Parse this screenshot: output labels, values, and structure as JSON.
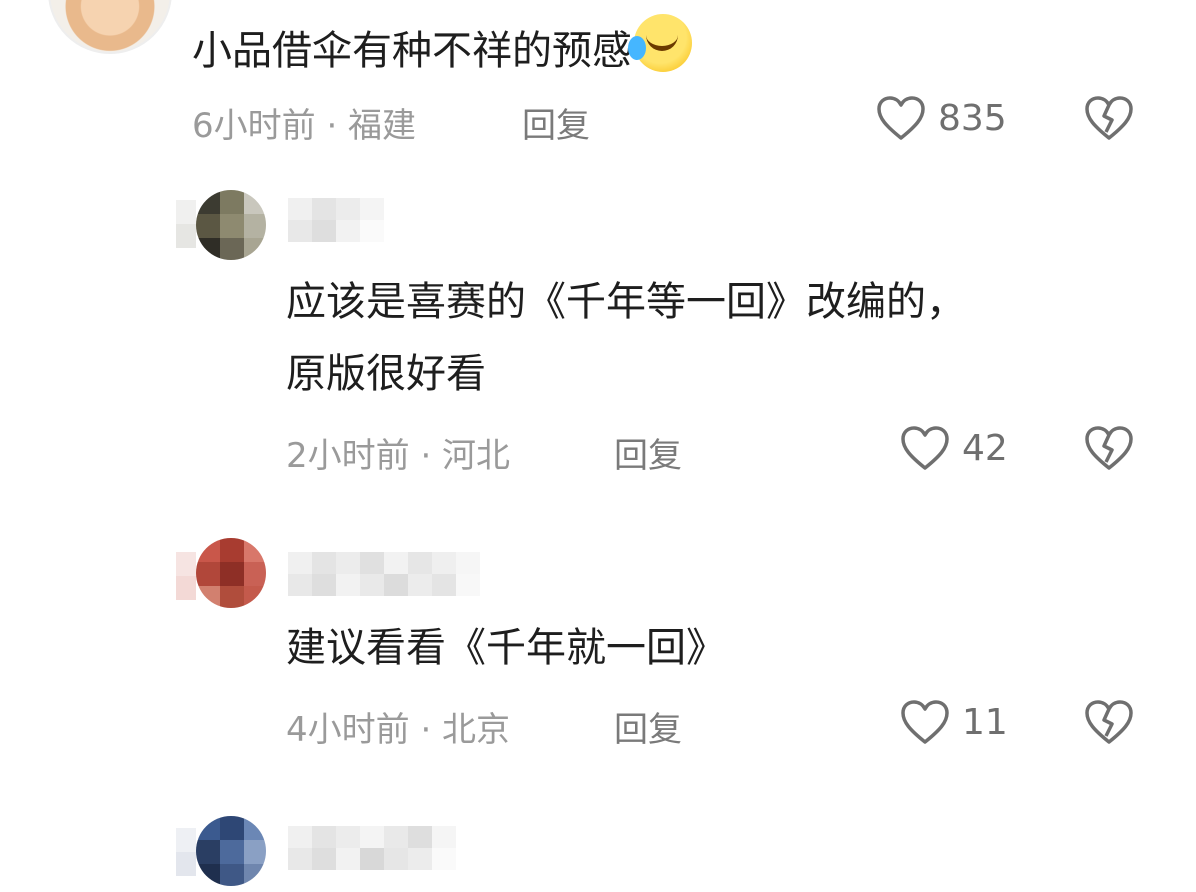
{
  "comments": [
    {
      "text": "小品借伞有种不祥的预感",
      "emoji_icon": "laughing-tears-emoji-icon",
      "meta": "6小时前 · 福建",
      "reply_label": "回复",
      "likes": "835"
    },
    {
      "text_line1": "应该是喜赛的《千年等一回》改编的，",
      "text_line2": "原版很好看",
      "meta": "2小时前 · 河北",
      "reply_label": "回复",
      "likes": "42"
    },
    {
      "text": "建议看看《千年就一回》",
      "meta": "4小时前 · 北京",
      "reply_label": "回复",
      "likes": "11"
    }
  ],
  "colors": {
    "text": "#1e1e1e",
    "meta": "#9a9a9a",
    "icon": "#6f6f6f",
    "background": "#ffffff"
  }
}
